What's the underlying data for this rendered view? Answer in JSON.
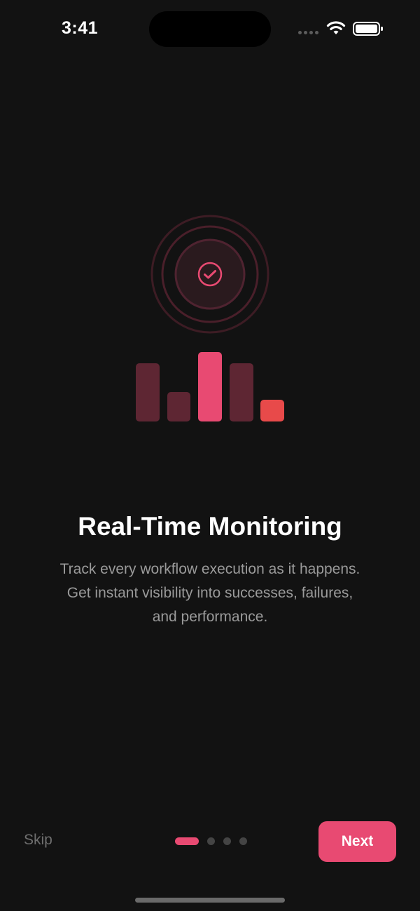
{
  "status_bar": {
    "time": "3:41",
    "icons": [
      "cellular-signal-icon",
      "wifi-icon",
      "battery-icon"
    ]
  },
  "illustration": {
    "icons": [
      "pulse-rings-icon",
      "check-circle-icon",
      "bar-chart-icon"
    ],
    "colors": {
      "accent": "#e84a72",
      "muted_bar": "#5e2633",
      "warning_bar": "#e84a4a",
      "ring": "#4a1f2a"
    }
  },
  "onboarding": {
    "title": "Real-Time Monitoring",
    "description_lines": [
      "Track every workflow execution as it happens.",
      "Get instant visibility into successes, failures,",
      "and performance."
    ]
  },
  "controls": {
    "skip_label": "Skip",
    "next_label": "Next",
    "page_count": 4,
    "current_page": 1
  },
  "colors": {
    "background": "#121212",
    "accent": "#e84a72",
    "secondary_text": "#9a9a9a"
  }
}
